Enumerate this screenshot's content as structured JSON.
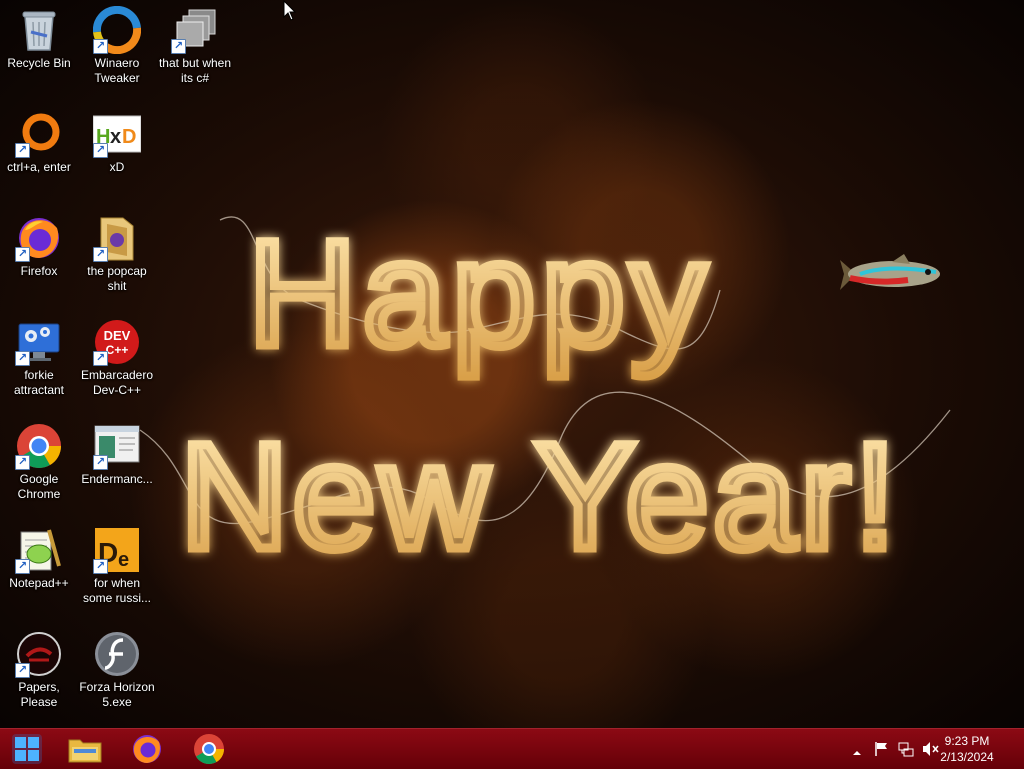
{
  "desktop": {
    "wallpaper": {
      "line1": "Happy",
      "line2": "New Year!",
      "glow_color": "#ffd98a",
      "tube_color": "#f3c777"
    },
    "icons": [
      {
        "label": "Recycle Bin",
        "icon": "recycle-bin-icon",
        "shortcut": false
      },
      {
        "label": "Winaero Tweaker",
        "icon": "winaero-tweaker-icon",
        "shortcut": true
      },
      {
        "label": "that but when its c#",
        "icon": "stacked-windows-icon",
        "shortcut": true
      },
      {
        "label": "ctrl+a, enter",
        "icon": "orange-ring-icon",
        "shortcut": true
      },
      {
        "label": "xD",
        "icon": "hxd-icon",
        "shortcut": true
      },
      {
        "label": "Firefox",
        "icon": "firefox-icon",
        "shortcut": true
      },
      {
        "label": "the popcap shit",
        "icon": "folder-icon",
        "shortcut": true
      },
      {
        "label": "forkie attractant",
        "icon": "monitor-gear-icon",
        "shortcut": true
      },
      {
        "label": "Embarcadero Dev-C++",
        "icon": "devcpp-icon",
        "shortcut": true
      },
      {
        "label": "Google Chrome",
        "icon": "chrome-icon",
        "shortcut": true
      },
      {
        "label": "Endermanc...",
        "icon": "window-app-icon",
        "shortcut": true
      },
      {
        "label": "Notepad++",
        "icon": "notepadpp-icon",
        "shortcut": true
      },
      {
        "label": "for when some russi...",
        "icon": "de-icon",
        "shortcut": true
      },
      {
        "label": "Papers, Please",
        "icon": "papers-please-icon",
        "shortcut": true
      },
      {
        "label": "Forza Horizon 5.exe",
        "icon": "flash-icon",
        "shortcut": true
      }
    ]
  },
  "taskbar": {
    "buttons": [
      {
        "name": "start-button",
        "icon": "windows-logo-icon"
      },
      {
        "name": "file-explorer",
        "icon": "folder-icon"
      },
      {
        "name": "firefox",
        "icon": "firefox-icon"
      },
      {
        "name": "chrome",
        "icon": "chrome-icon"
      }
    ],
    "tray": {
      "icons": [
        "chevron-up-icon",
        "flag-icon",
        "network-icon",
        "volume-muted-icon"
      ],
      "time": "9:23 PM",
      "date": "2/13/2024"
    },
    "colors": {
      "bar": "#7a0710",
      "text": "#ffffff"
    }
  }
}
